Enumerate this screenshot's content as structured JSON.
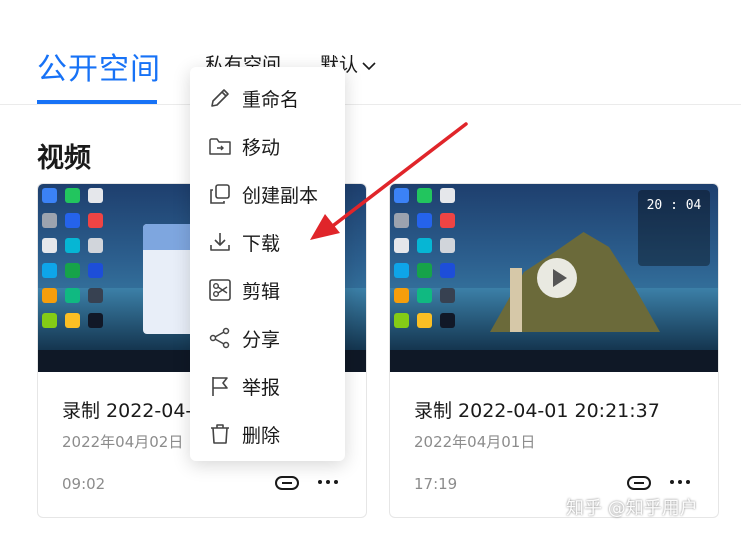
{
  "tabs": {
    "public_space": "公开空间",
    "private_space": "私有空间",
    "default_filter": "默认"
  },
  "section": {
    "title": "视频"
  },
  "videos": [
    {
      "title": "录制 2022-04-02 09:02:xx",
      "date": "2022年04月02日",
      "duration": "09:02"
    },
    {
      "title": "录制 2022-04-01 20:21:37",
      "date": "2022年04月01日",
      "duration": "17:19",
      "clock": "20 : 04"
    }
  ],
  "context_menu": {
    "items": [
      {
        "label": "重命名",
        "icon": "pencil-icon"
      },
      {
        "label": "移动",
        "icon": "folder-move-icon"
      },
      {
        "label": "创建副本",
        "icon": "copy-icon"
      },
      {
        "label": "下载",
        "icon": "download-icon"
      },
      {
        "label": "剪辑",
        "icon": "scissors-icon"
      },
      {
        "label": "分享",
        "icon": "share-icon"
      },
      {
        "label": "举报",
        "icon": "flag-icon"
      },
      {
        "label": "删除",
        "icon": "trash-icon"
      }
    ]
  },
  "watermark": "知乎 @知乎用户",
  "colors": {
    "accent": "#1772f6",
    "arrow": "#e0252a"
  }
}
